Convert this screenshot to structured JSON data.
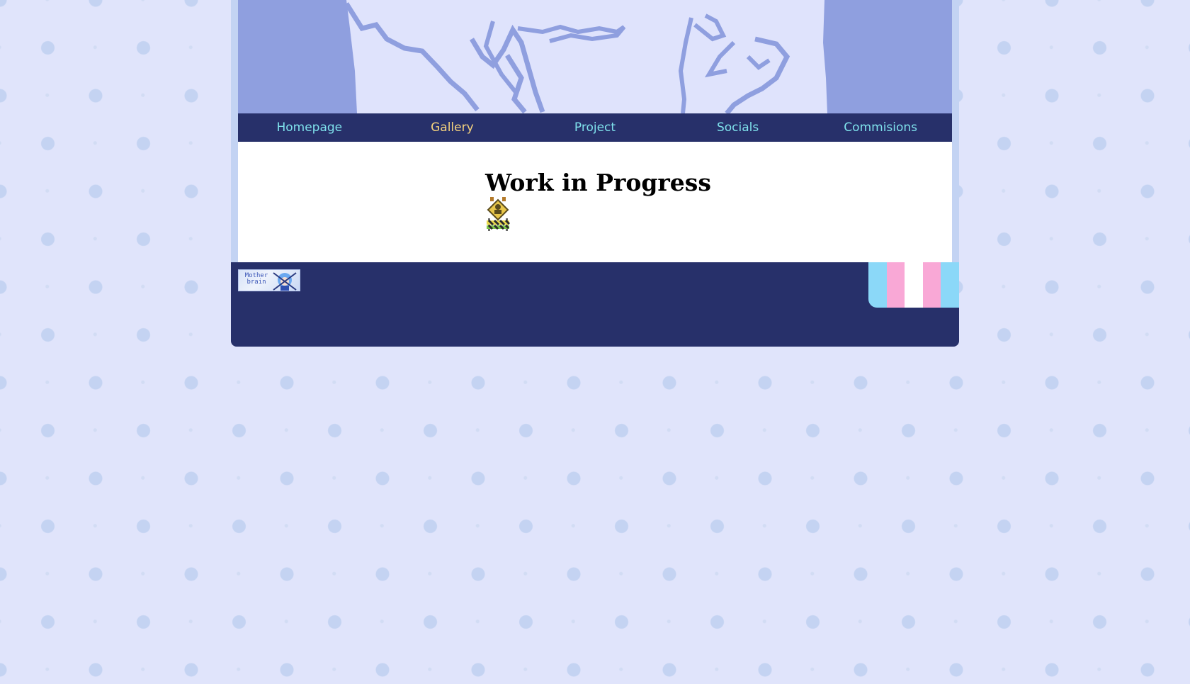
{
  "nav": {
    "items": [
      {
        "label": "Homepage"
      },
      {
        "label": "Gallery"
      },
      {
        "label": "Project"
      },
      {
        "label": "Socials"
      },
      {
        "label": "Commisions"
      }
    ],
    "active": "Gallery"
  },
  "main": {
    "title": "Work in Progress",
    "icon": "under-construction-sign-icon"
  },
  "footer": {
    "badge_label": "Mother brain",
    "flag_colors": [
      "#8bd8f8",
      "#f9a8d6",
      "#ffffff",
      "#f9a8d6",
      "#8bd8f8"
    ]
  },
  "colors": {
    "background": "#e0e4fb",
    "nav_background": "#27306a",
    "nav_link": "#7fe2ec",
    "nav_active": "#f6d37e",
    "banner_art": "#8f9fdf"
  }
}
